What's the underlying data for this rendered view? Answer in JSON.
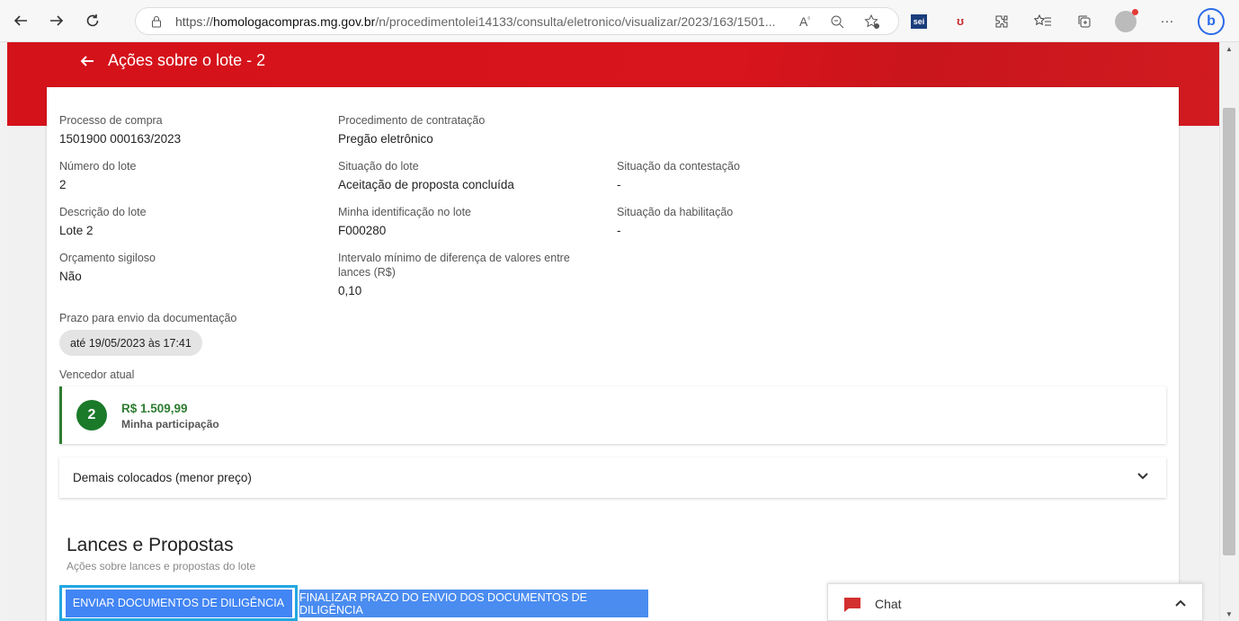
{
  "browser": {
    "url_prefix": "https://",
    "url_host": "homologacompras.mg.gov.br",
    "url_path": "/n/procedimentolei14133/consulta/eletronico/visualizar/2023/163/1501...",
    "sei_label": "sei",
    "pdf_label": "ʊ",
    "bing_label": "b"
  },
  "header": {
    "title": "Ações sobre o lote - 2"
  },
  "details": {
    "processo": {
      "label": "Processo de compra",
      "value": "1501900 000163/2023"
    },
    "procedimento": {
      "label": "Procedimento de contratação",
      "value": "Pregão eletrônico"
    },
    "numero_lote": {
      "label": "Número do lote",
      "value": "2"
    },
    "situacao_lote": {
      "label": "Situação do lote",
      "value": "Aceitação de proposta concluída"
    },
    "situacao_contestacao": {
      "label": "Situação da contestação",
      "value": "-"
    },
    "descricao_lote": {
      "label": "Descrição do lote",
      "value": "Lote 2"
    },
    "identificacao": {
      "label": "Minha identificação no lote",
      "value": "F000280"
    },
    "situacao_habilitacao": {
      "label": "Situação da habilitação",
      "value": "-"
    },
    "orcamento": {
      "label": "Orçamento sigiloso",
      "value": "Não"
    },
    "intervalo": {
      "label": "Intervalo mínimo de diferença de valores entre lances (R$)",
      "value": "0,10"
    },
    "prazo": {
      "label": "Prazo para envio da documentação",
      "value": "até 19/05/2023 às 17:41"
    }
  },
  "vencedor": {
    "label": "Vencedor atual",
    "rank": "2",
    "price": "R$ 1.509,99",
    "participation": "Minha participação"
  },
  "demais": {
    "label": "Demais colocados (menor preço)"
  },
  "lances": {
    "title": "Lances e Propostas",
    "subtitle": "Ações sobre lances e propostas do lote",
    "btn_enviar": "ENVIAR DOCUMENTOS DE DILIGÊNCIA",
    "btn_finalizar": "FINALIZAR PRAZO DO ENVIO DOS DOCUMENTOS DE DILIGÊNCIA"
  },
  "chat": {
    "label": "Chat"
  },
  "colors": {
    "brand_red": "#d4121a",
    "winner_green": "#1b7a2a",
    "button_blue": "#4285f4",
    "focus_outline": "#22a7e0"
  }
}
